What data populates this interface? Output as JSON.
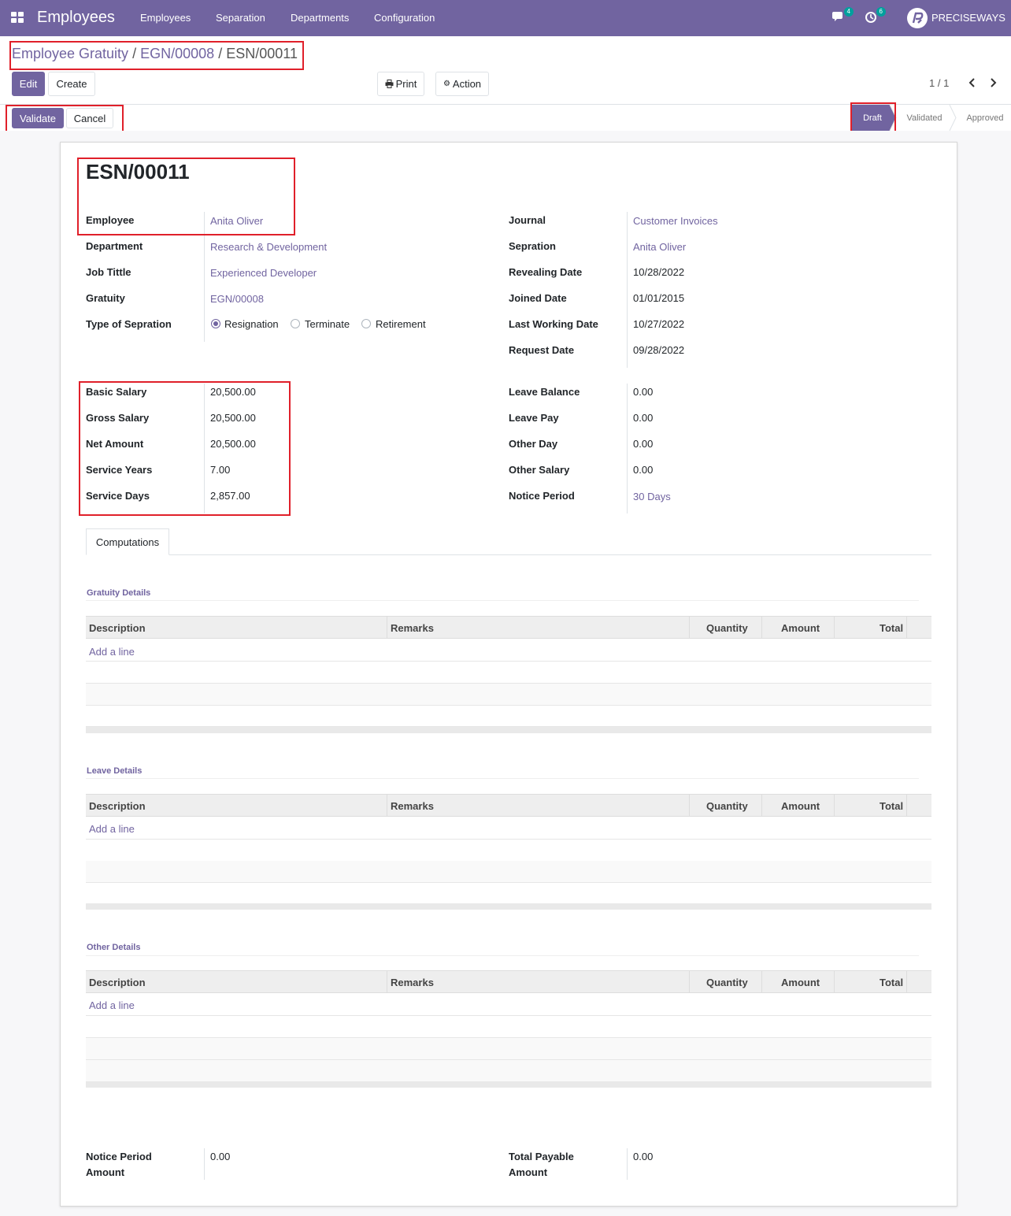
{
  "topbar": {
    "app_title": "Employees",
    "menu": [
      "Employees",
      "Separation",
      "Departments",
      "Configuration"
    ],
    "messages_count": "4",
    "activities_count": "6",
    "company": "PRECISEWAYS"
  },
  "breadcrumb": {
    "root": "Employee Gratuity",
    "sep": "/",
    "parent": "EGN/00008",
    "current": "ESN/00011"
  },
  "toolbar": {
    "edit": "Edit",
    "create": "Create",
    "print": "Print",
    "action": "Action",
    "pager": "1 / 1"
  },
  "statusbar": {
    "validate": "Validate",
    "cancel": "Cancel",
    "steps": [
      "Draft",
      "Validated",
      "Approved"
    ],
    "active_step": "Draft"
  },
  "form": {
    "title": "ESN/00011",
    "left": [
      {
        "label": "Employee",
        "value": "Anita Oliver"
      },
      {
        "label": "Department",
        "value": "Research & Development"
      },
      {
        "label": "Job Tittle",
        "value": "Experienced Developer"
      },
      {
        "label": "Gratuity",
        "value": "EGN/00008"
      },
      {
        "label": "Type of Sepration",
        "value": ""
      }
    ],
    "separation_types": [
      "Resignation",
      "Terminate",
      "Retirement"
    ],
    "separation_selected": "Resignation",
    "right": [
      {
        "label": "Journal",
        "value": "Customer Invoices"
      },
      {
        "label": "Sepration",
        "value": "Anita Oliver"
      },
      {
        "label": "Revealing Date",
        "value": "10/28/2022"
      },
      {
        "label": "Joined Date",
        "value": "01/01/2015"
      },
      {
        "label": "Last Working Date",
        "value": "10/27/2022"
      },
      {
        "label": "Request Date",
        "value": "09/28/2022"
      }
    ],
    "salary_left": [
      {
        "label": "Basic Salary",
        "value": "20,500.00"
      },
      {
        "label": "Gross Salary",
        "value": "20,500.00"
      },
      {
        "label": "Net Amount",
        "value": "20,500.00"
      },
      {
        "label": "Service Years",
        "value": "7.00"
      },
      {
        "label": "Service Days",
        "value": "2,857.00"
      }
    ],
    "salary_right": [
      {
        "label": "Leave Balance",
        "value": "0.00"
      },
      {
        "label": "Leave Pay",
        "value": "0.00"
      },
      {
        "label": "Other Day",
        "value": "0.00"
      },
      {
        "label": "Other Salary",
        "value": "0.00"
      },
      {
        "label": "Notice Period",
        "value": "30 Days"
      }
    ],
    "tab": "Computations",
    "sections": [
      "Gratuity Details",
      "Leave Details",
      "Other Details"
    ],
    "columns": [
      "Description",
      "Remarks",
      "Quantity",
      "Amount",
      "Total"
    ],
    "add_line": "Add a line",
    "notice_period_amount": {
      "label_1": "Notice Period",
      "label_2": "Amount",
      "value": "0.00"
    },
    "total_payable_amount": {
      "label_1": "Total Payable",
      "label_2": "Amount",
      "value": "0.00"
    }
  },
  "colors": {
    "primary": "#7164a0",
    "highlight": "#e0202a"
  }
}
